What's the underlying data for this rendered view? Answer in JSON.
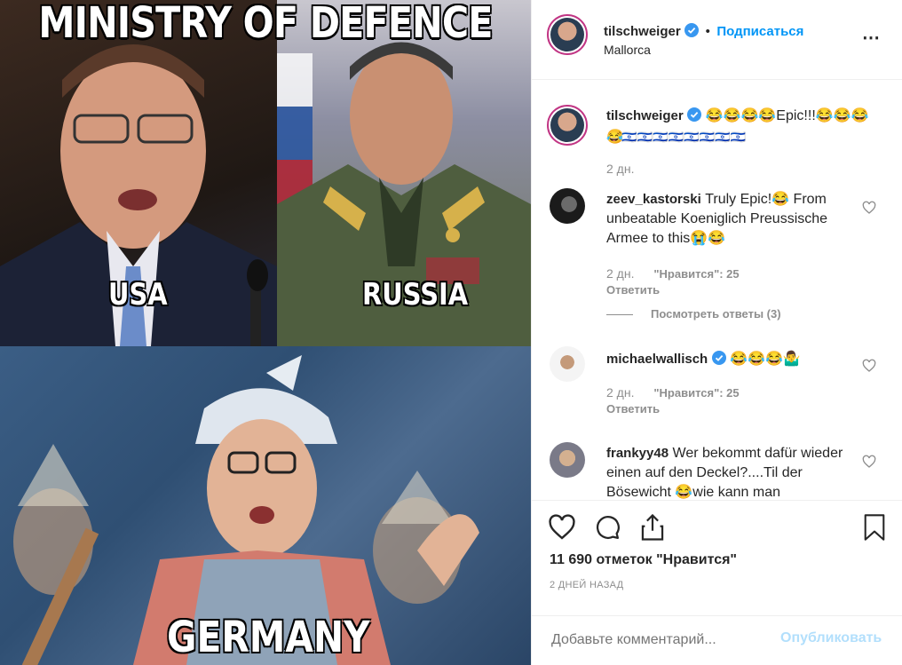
{
  "meme": {
    "title": "MINISTRY OF DEFENCE",
    "label_usa": "USA",
    "label_russia": "RUSSIA",
    "label_germany": "GERMANY"
  },
  "header": {
    "username": "tilschweiger",
    "separator": "•",
    "follow_label": "Подписаться",
    "location": "Mallorca",
    "more_label": "⋯"
  },
  "caption": {
    "username": "tilschweiger",
    "text": "😂😂😂😂Epic!!!😂😂😂😂",
    "text_line2": "😂🇮🇱🇮🇱🇮🇱🇮🇱🇮🇱🇮🇱🇮🇱🇮🇱",
    "time": "2 дн."
  },
  "comments": [
    {
      "username": "zeev_kastorski",
      "text": "Truly Epic!😂 From unbeatable Koeniglich Preussische Armee to this😭😂",
      "time": "2 дн.",
      "likes": "\"Нравится\": 25",
      "reply_label": "Ответить",
      "view_replies": "Посмотреть ответы (3)"
    },
    {
      "username": "michaelwallisch",
      "text": "😂😂😂🤷‍♂️",
      "time": "2 дн.",
      "likes": "\"Нравится\": 25",
      "reply_label": "Ответить"
    },
    {
      "username": "frankyy48",
      "text": "Wer bekommt dafür wieder einen auf den Deckel?....Til der Bösewicht 😂wie kann man",
      "time": ""
    }
  ],
  "footer": {
    "likes": "11 690 отметок \"Нравится\"",
    "date": "2 ДНЕЙ НАЗАД",
    "comment_placeholder": "Добавьте комментарий...",
    "publish_label": "Опубликовать"
  },
  "colors": {
    "accent": "#0095f6",
    "publish_disabled": "#b2dffc",
    "muted": "#8e8e8e",
    "border": "#efefef",
    "verified": "#3897f0"
  }
}
